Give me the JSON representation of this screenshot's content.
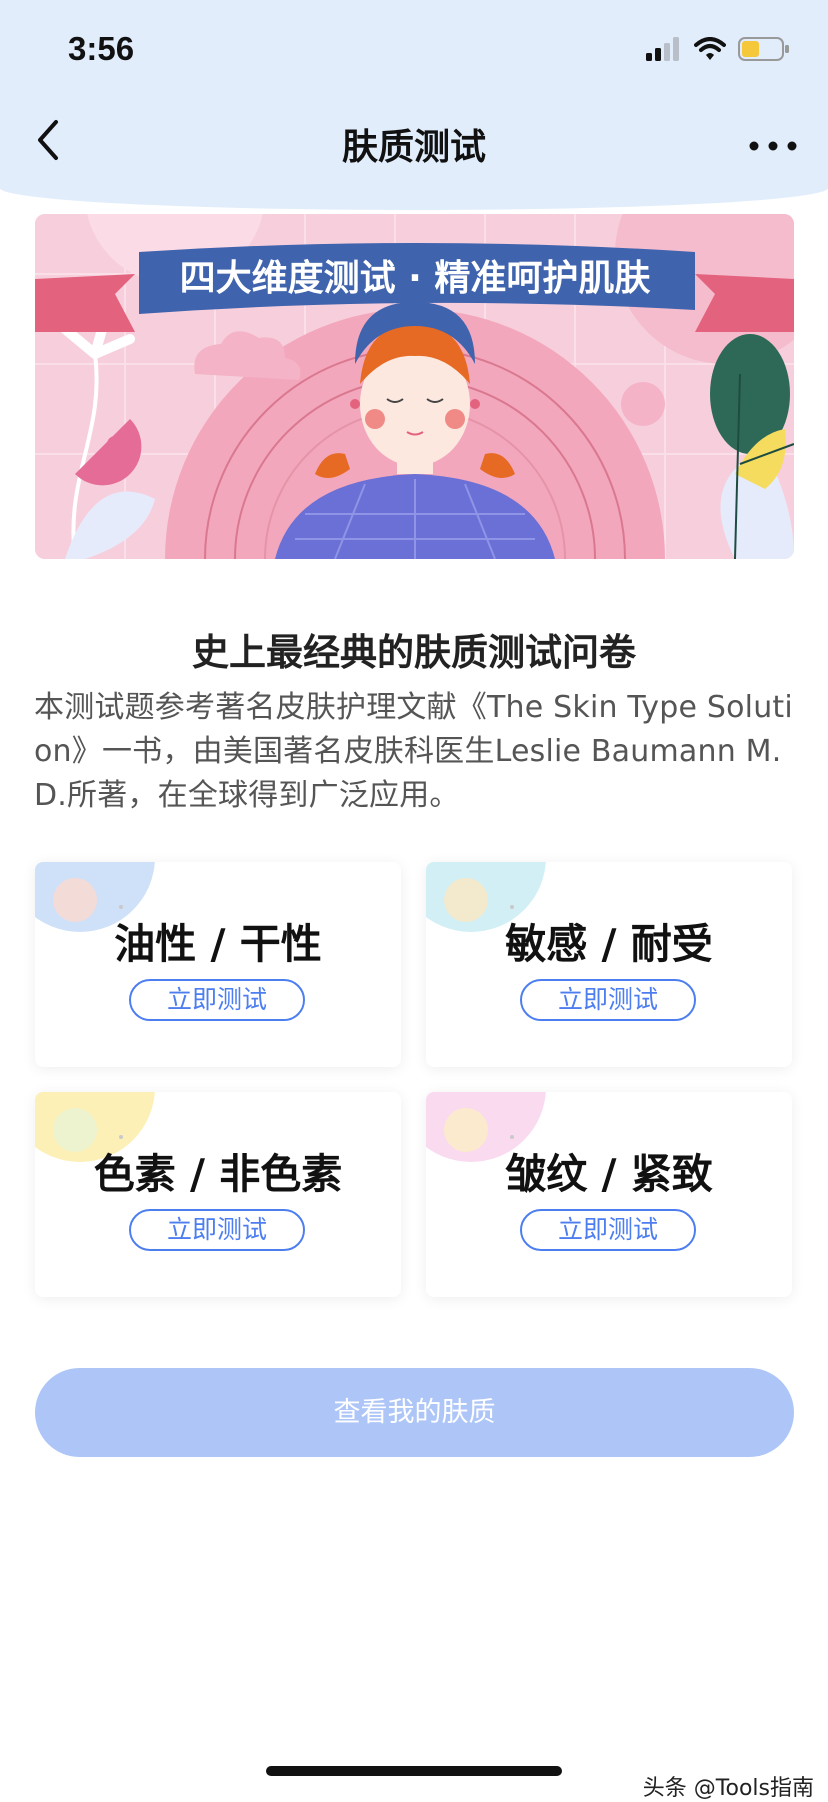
{
  "status_bar": {
    "time": "3:56",
    "icons": [
      "signal-icon",
      "wifi-icon",
      "battery-icon"
    ]
  },
  "nav": {
    "title": "肤质测试",
    "back_icon": "chevron-left-icon",
    "more_icon": "more-dots-icon"
  },
  "banner": {
    "ribbon_text": "四大维度测试 · 精准呵护肌肤"
  },
  "intro": {
    "title": "史上最经典的肤质测试问卷",
    "body": "本测试题参考著名皮肤护理文献《The Skin Type Solution》一书，由美国著名皮肤科医生Leslie Baumann M.D.所著，在全球得到广泛应用。"
  },
  "tests": [
    {
      "title": "油性 / 干性",
      "button": "立即测试",
      "accent": "#c7dcf7"
    },
    {
      "title": "敏感 / 耐受",
      "button": "立即测试",
      "accent": "#c9ecf3"
    },
    {
      "title": "色素 / 非色素",
      "button": "立即测试",
      "accent": "#fbeda9"
    },
    {
      "title": "皱纹 / 紧致",
      "button": "立即测试",
      "accent": "#f8d4ec"
    }
  ],
  "primary_button": "查看我的肤质",
  "watermark": "头条 @Tools指南",
  "colors": {
    "header_bg": "#e2edfc",
    "accent_blue": "#4d7ef0",
    "primary_disabled": "#adc6f7"
  }
}
